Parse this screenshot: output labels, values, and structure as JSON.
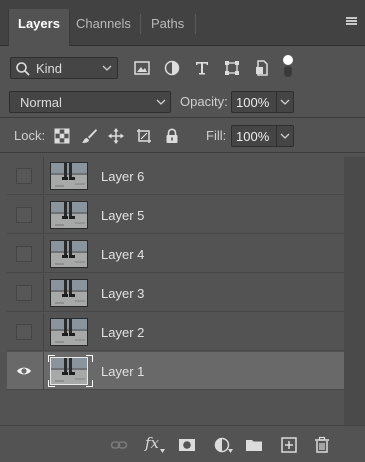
{
  "tabs": [
    {
      "label": "Layers",
      "active": true
    },
    {
      "label": "Channels",
      "active": false
    },
    {
      "label": "Paths",
      "active": false
    }
  ],
  "filter": {
    "kind_label": "Kind",
    "icons": [
      "image-filter-icon",
      "adjustment-filter-icon",
      "type-filter-icon",
      "shape-filter-icon",
      "smart-object-filter-icon",
      "filter-toggle-icon"
    ]
  },
  "blend": {
    "mode": "Normal",
    "opacity_label": "Opacity:",
    "opacity_value": "100%"
  },
  "lock": {
    "label": "Lock:",
    "fill_label": "Fill:",
    "fill_value": "100%",
    "icons": [
      "lock-transparent-pixels-icon",
      "lock-image-pixels-icon",
      "lock-position-icon",
      "prevent-auto-nesting-icon",
      "lock-all-icon"
    ]
  },
  "layers": [
    {
      "name": "Layer 6",
      "visible": false,
      "selected": false
    },
    {
      "name": "Layer 5",
      "visible": false,
      "selected": false
    },
    {
      "name": "Layer 4",
      "visible": false,
      "selected": false
    },
    {
      "name": "Layer 3",
      "visible": false,
      "selected": false
    },
    {
      "name": "Layer 2",
      "visible": false,
      "selected": false
    },
    {
      "name": "Layer 1",
      "visible": true,
      "selected": true
    }
  ],
  "footer_icons": [
    "link-layers-icon",
    "layer-style-fx-icon",
    "add-mask-icon",
    "adjustment-layer-icon",
    "new-group-icon",
    "new-layer-icon",
    "delete-layer-icon"
  ],
  "footer_fx_label": "fx",
  "colors": {
    "panel": "#535353",
    "tabbar": "#424242",
    "selected_row": "#696969"
  }
}
